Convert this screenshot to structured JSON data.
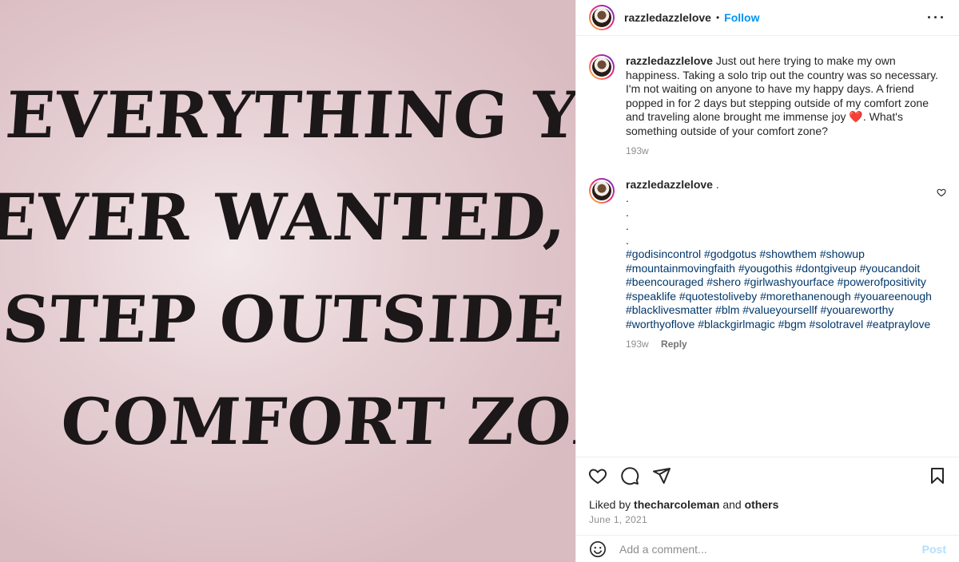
{
  "media": {
    "quote_lines": [
      "EVERYTHING YOU'VE",
      "EVER WANTED, IS ONE",
      "STEP OUTSIDE YOUR",
      "COMFORT ZONE."
    ]
  },
  "header": {
    "username": "razzledazzlelove",
    "separator": "•",
    "follow_label": "Follow",
    "more_icon": "more-horizontal-icon",
    "more_label": "···"
  },
  "caption": {
    "username": "razzledazzlelove",
    "text": "Just out here trying to make my own happiness. Taking a solo trip out the country was so necessary. I'm not waiting on anyone to have my happy days. A friend popped in for 2 days but stepping outside of my comfort zone and traveling alone brought me immense joy",
    "emoji": "❤️",
    "text_after": ". What's something outside of your comfort zone?",
    "time": "193w"
  },
  "comment": {
    "username": "razzledazzlelove",
    "text": ".",
    "dots": [
      ".",
      ".",
      ".",
      "."
    ],
    "hashtags": "#godisincontrol #godgotus #showthem #showup #mountainmovingfaith #yougothis #dontgiveup #youcandoit #beencouraged #shero #girlwashyourface #powerofpositivity #speaklife #quotestoliveby #morethanenough #youareenough #blacklivesmatter #blm #valueyoursellf #youareworthy #worthyoflove #blackgirlmagic #bgm #solotravel #eatpraylove",
    "time": "193w",
    "reply_label": "Reply",
    "like_icon": "heart-outline-icon"
  },
  "actions": {
    "like_icon": "heart-icon",
    "comment_icon": "comment-icon",
    "share_icon": "share-icon",
    "save_icon": "bookmark-icon"
  },
  "likes": {
    "prefix": "Liked by",
    "user": "thecharcoleman",
    "and": "and",
    "others": "others"
  },
  "date": "June 1, 2021",
  "add_comment": {
    "placeholder": "Add a comment...",
    "post_label": "Post",
    "emoji_icon": "smiley-icon"
  },
  "colors": {
    "accent": "#0095f6",
    "hashtag": "#00376b",
    "muted": "#8e8e8e"
  }
}
